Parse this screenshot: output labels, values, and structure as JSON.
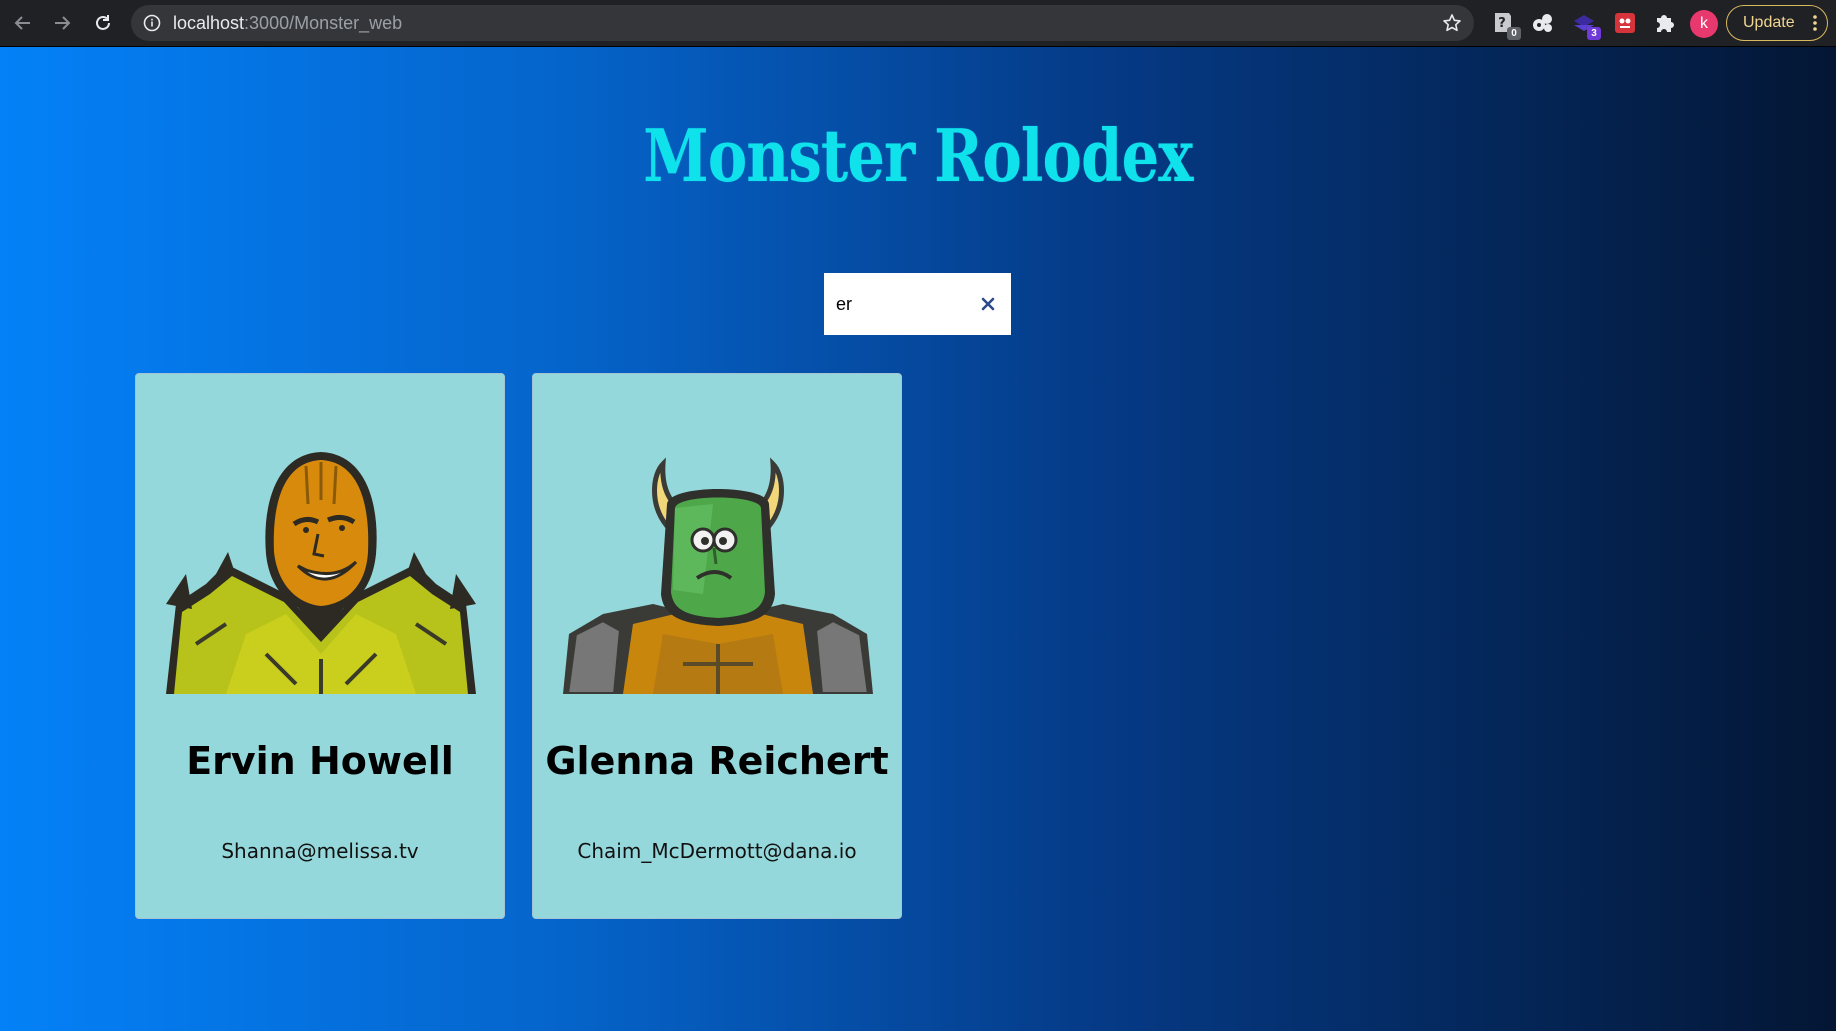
{
  "browser": {
    "url_host": "localhost",
    "url_rest": ":3000/Monster_web",
    "extensions": [
      {
        "icon": "puzzle-help-extension-icon",
        "badge": "0"
      },
      {
        "icon": "cookie-extension-icon"
      },
      {
        "icon": "purple-extension-icon",
        "badge": "3"
      },
      {
        "icon": "red-extension-icon"
      },
      {
        "icon": "extensions-puzzle-icon"
      }
    ],
    "profile_initial": "k",
    "update_label": "Update"
  },
  "page": {
    "title": "Monster Rolodex",
    "search": {
      "value": "er",
      "placeholder": "search monsters"
    },
    "monsters": [
      {
        "name": "Ervin Howell",
        "email": "Shanna@melissa.tv",
        "icon": "yellow-monster-avatar"
      },
      {
        "name": "Glenna Reichert",
        "email": "Chaim_McDermott@dana.io",
        "icon": "green-horned-monster-avatar"
      }
    ]
  },
  "colors": {
    "title": "#10e2ec",
    "card": "#95d8db",
    "gradient_left": "#0481f7",
    "gradient_right": "#041634"
  }
}
